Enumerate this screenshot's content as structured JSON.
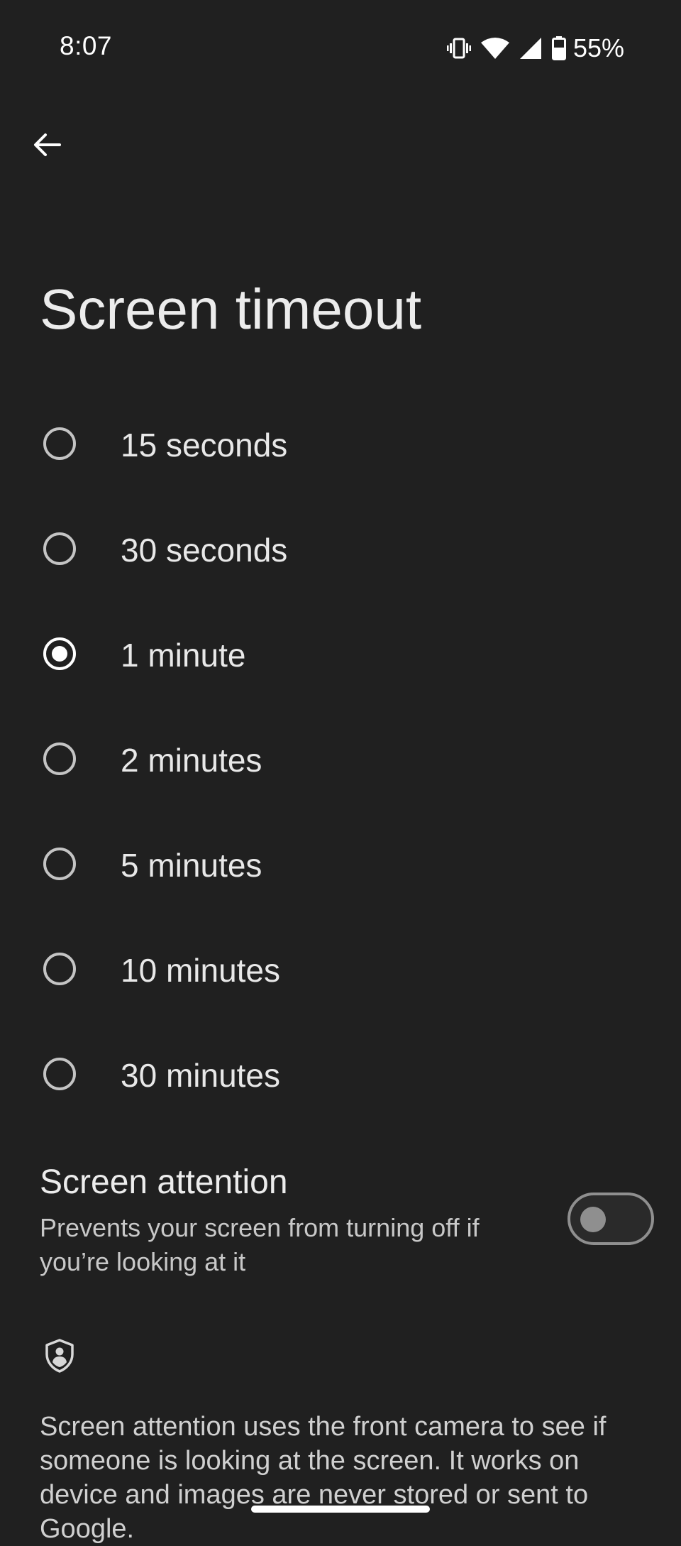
{
  "status_bar": {
    "time": "8:07",
    "battery_percent": "55%",
    "icons": [
      "vibrate-icon",
      "wifi-icon",
      "cell-signal-icon",
      "battery-icon"
    ]
  },
  "header": {
    "back_icon": "arrow-back-icon",
    "title": "Screen timeout"
  },
  "options": [
    {
      "label": "15 seconds",
      "selected": false
    },
    {
      "label": "30 seconds",
      "selected": false
    },
    {
      "label": "1 minute",
      "selected": true
    },
    {
      "label": "2 minutes",
      "selected": false
    },
    {
      "label": "5 minutes",
      "selected": false
    },
    {
      "label": "10 minutes",
      "selected": false
    },
    {
      "label": "30 minutes",
      "selected": false
    }
  ],
  "screen_attention": {
    "title": "Screen attention",
    "subtitle": "Prevents your screen from turning off if you’re looking at it",
    "enabled": false
  },
  "footer": {
    "icon": "shield-person-icon",
    "text": "Screen attention uses the front camera to see if someone is looking at the screen. It works on device and images are never stored or sent to Google."
  },
  "colors": {
    "background": "#202020",
    "text": "#e8e8e8",
    "radio": "#c4c4c4",
    "toggle_off": "#8f8f8f"
  }
}
